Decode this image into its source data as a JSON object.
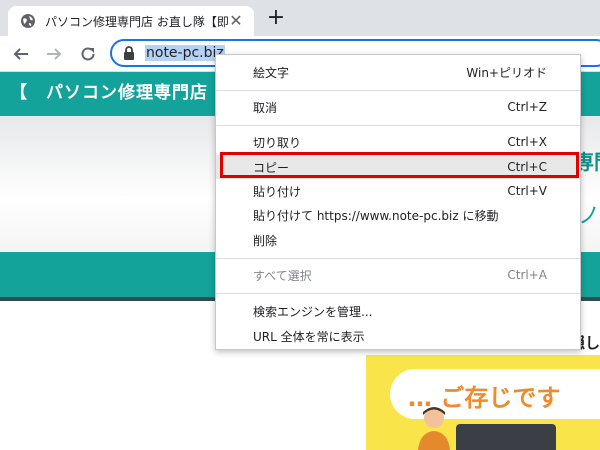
{
  "browser": {
    "tab_title": "パソコン修理専門店 お直し隊【即日",
    "tab_close_glyph": "✕",
    "new_tab_glyph": "+",
    "url": "note-pc.biz",
    "icons": {
      "favicon": "globe-icon",
      "back": "back-arrow-icon",
      "forward": "forward-arrow-icon",
      "reload": "reload-icon",
      "lock": "lock-icon"
    },
    "accent_color": "#1a73e8"
  },
  "page": {
    "site_title": "【　パソコン修理専門店",
    "banner_text_1": "専門",
    "banner_text_2": "ノ",
    "promo_text": "隠し",
    "promo_bubble": "… ご存じです",
    "brand_color": "#14a39a"
  },
  "context_menu": {
    "items": [
      {
        "label": "絵文字",
        "shortcut": "Win+ピリオド"
      },
      {
        "label": "取消",
        "shortcut": "Ctrl+Z"
      },
      {
        "label": "切り取り",
        "shortcut": "Ctrl+X"
      },
      {
        "label": "コピー",
        "shortcut": "Ctrl+C"
      },
      {
        "label": "貼り付け",
        "shortcut": "Ctrl+V"
      },
      {
        "label": "貼り付けて https://www.note-pc.biz に移動",
        "shortcut": ""
      },
      {
        "label": "削除",
        "shortcut": ""
      },
      {
        "label": "すべて選択",
        "shortcut": "Ctrl+A"
      },
      {
        "label": "検索エンジンを管理...",
        "shortcut": ""
      },
      {
        "label": "URL 全体を常に表示",
        "shortcut": ""
      }
    ],
    "highlighted_item": "コピー",
    "highlight_color": "#e00000"
  }
}
